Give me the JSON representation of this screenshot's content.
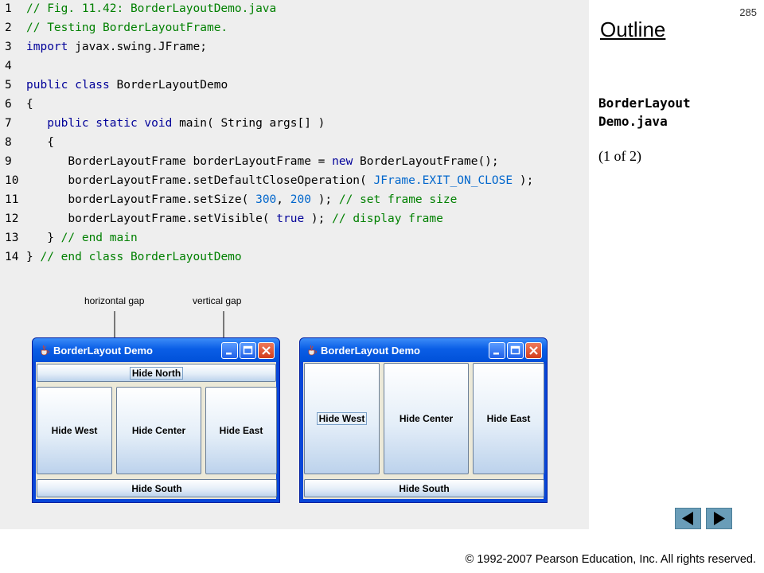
{
  "page_number": "285",
  "outline": "Outline",
  "file_name_line1": "BorderLayout",
  "file_name_line2": "Demo.java",
  "page_info": "(1 of 2)",
  "code_lines": [
    {
      "n": "1",
      "parts": [
        {
          "t": "// Fig. 11.42: BorderLayoutDemo.java",
          "c": "c-com"
        }
      ]
    },
    {
      "n": "2",
      "parts": [
        {
          "t": "// Testing BorderLayoutFrame.",
          "c": "c-com"
        }
      ]
    },
    {
      "n": "3",
      "parts": [
        {
          "t": "import",
          "c": "c-kw"
        },
        {
          "t": " javax.swing.JFrame;",
          "c": ""
        }
      ]
    },
    {
      "n": "4",
      "parts": []
    },
    {
      "n": "5",
      "parts": [
        {
          "t": "public class",
          "c": "c-kw"
        },
        {
          "t": " BorderLayoutDemo",
          "c": ""
        }
      ]
    },
    {
      "n": "6",
      "parts": [
        {
          "t": "{",
          "c": ""
        }
      ]
    },
    {
      "n": "7",
      "parts": [
        {
          "t": "   ",
          "c": ""
        },
        {
          "t": "public static void",
          "c": "c-kw"
        },
        {
          "t": " main( String args[] )",
          "c": ""
        }
      ]
    },
    {
      "n": "8",
      "parts": [
        {
          "t": "   {",
          "c": ""
        }
      ]
    },
    {
      "n": "9",
      "parts": [
        {
          "t": "      BorderLayoutFrame borderLayoutFrame = ",
          "c": ""
        },
        {
          "t": "new",
          "c": "c-kw"
        },
        {
          "t": " BorderLayoutFrame();",
          "c": ""
        }
      ]
    },
    {
      "n": "10",
      "parts": [
        {
          "t": "      borderLayoutFrame.setDefaultCloseOperation( ",
          "c": ""
        },
        {
          "t": "JFrame.EXIT_ON_CLOSE",
          "c": "c-const"
        },
        {
          "t": " );",
          "c": ""
        }
      ]
    },
    {
      "n": "11",
      "parts": [
        {
          "t": "      borderLayoutFrame.setSize( ",
          "c": ""
        },
        {
          "t": "300",
          "c": "c-num"
        },
        {
          "t": ", ",
          "c": ""
        },
        {
          "t": "200",
          "c": "c-num"
        },
        {
          "t": " ); ",
          "c": ""
        },
        {
          "t": "// set frame size",
          "c": "c-com"
        }
      ]
    },
    {
      "n": "12",
      "parts": [
        {
          "t": "      borderLayoutFrame.setVisible( ",
          "c": ""
        },
        {
          "t": "true",
          "c": "c-kw"
        },
        {
          "t": " ); ",
          "c": ""
        },
        {
          "t": "// display frame",
          "c": "c-com"
        }
      ]
    },
    {
      "n": "13",
      "parts": [
        {
          "t": "   } ",
          "c": ""
        },
        {
          "t": "// end main",
          "c": "c-com"
        }
      ]
    },
    {
      "n": "14",
      "parts": [
        {
          "t": "} ",
          "c": ""
        },
        {
          "t": "// end class BorderLayoutDemo",
          "c": "c-com"
        }
      ]
    }
  ],
  "annotations": {
    "horizontal_gap": "horizontal gap",
    "vertical_gap": "vertical gap"
  },
  "window1": {
    "title": "BorderLayout Demo",
    "north": "Hide North",
    "west": "Hide West",
    "center": "Hide Center",
    "east": "Hide East",
    "south": "Hide South"
  },
  "window2": {
    "title": "BorderLayout Demo",
    "west": "Hide West",
    "center": "Hide Center",
    "east": "Hide East",
    "south": "Hide South"
  },
  "copyright": "© 1992-2007 Pearson Education, Inc.  All rights reserved.",
  "colors": {
    "comment": "#008000",
    "keyword": "#000099",
    "constant": "#0066cc",
    "title_bar": "#0a5ee6",
    "nav_button": "#6a9db8"
  },
  "icons": {
    "prev": "prev-arrow-icon",
    "next": "next-arrow-icon",
    "java": "java-cup-icon"
  }
}
